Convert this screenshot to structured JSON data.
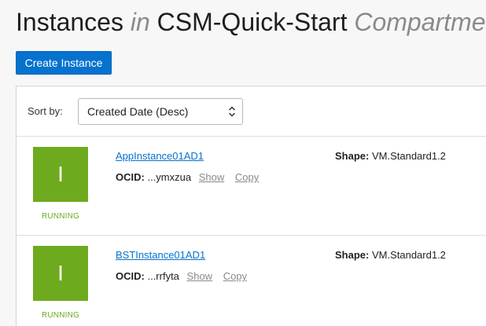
{
  "header": {
    "title_part1": "Instances",
    "title_in": "in",
    "compartment": "CSM-Quick-Start",
    "title_part2": "Compartment"
  },
  "toolbar": {
    "create_label": "Create Instance"
  },
  "sort": {
    "label": "Sort by:",
    "selected": "Created Date (Desc)"
  },
  "labels": {
    "shape": "Shape:",
    "ocid": "OCID:",
    "show": "Show",
    "copy": "Copy"
  },
  "instances": [
    {
      "initial": "I",
      "status": "RUNNING",
      "name": "AppInstance01AD1",
      "ocid_short": "...ymxzua",
      "shape": "VM.Standard1.2"
    },
    {
      "initial": "I",
      "status": "RUNNING",
      "name": "BSTInstance01AD1",
      "ocid_short": "...rrfyta",
      "shape": "VM.Standard1.2"
    }
  ],
  "colors": {
    "primary": "#0572ce",
    "running": "#6eaa1e"
  }
}
